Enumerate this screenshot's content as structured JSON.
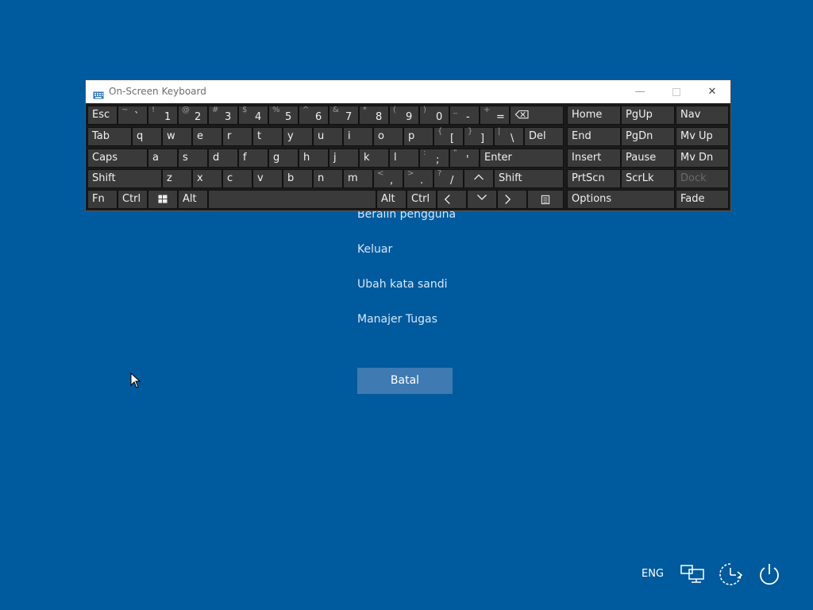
{
  "osk": {
    "title": "On-Screen Keyboard",
    "window_buttons": {
      "minimize": "—",
      "close": "✕"
    },
    "keys": {
      "esc": "Esc",
      "tilde": {
        "top": "~",
        "bottom": "`"
      },
      "d1": {
        "top": "!",
        "bottom": "1"
      },
      "d2": {
        "top": "@",
        "bottom": "2"
      },
      "d3": {
        "top": "#",
        "bottom": "3"
      },
      "d4": {
        "top": "$",
        "bottom": "4"
      },
      "d5": {
        "top": "%",
        "bottom": "5"
      },
      "d6": {
        "top": "^",
        "bottom": "6"
      },
      "d7": {
        "top": "&",
        "bottom": "7"
      },
      "d8": {
        "top": "*",
        "bottom": "8"
      },
      "d9": {
        "top": "(",
        "bottom": "9"
      },
      "d0": {
        "top": ")",
        "bottom": "0"
      },
      "minus": {
        "top": "_",
        "bottom": "-"
      },
      "equal": {
        "top": "+",
        "bottom": "="
      },
      "tab": "Tab",
      "q": "q",
      "w": "w",
      "e": "e",
      "r": "r",
      "t": "t",
      "y": "y",
      "u": "u",
      "i": "i",
      "o": "o",
      "p": "p",
      "lbracket": {
        "top": "{",
        "bottom": "["
      },
      "rbracket": {
        "top": "}",
        "bottom": "]"
      },
      "backslash": {
        "top": "|",
        "bottom": "\\"
      },
      "del": "Del",
      "caps": "Caps",
      "a": "a",
      "s": "s",
      "d": "d",
      "f": "f",
      "g": "g",
      "h": "h",
      "j": "j",
      "k": "k",
      "l": "l",
      "semicolon": {
        "top": ":",
        "bottom": ";"
      },
      "quote": {
        "top": "\"",
        "bottom": "'"
      },
      "enter": "Enter",
      "shift_left": "Shift",
      "z": "z",
      "x": "x",
      "c": "c",
      "v": "v",
      "b": "b",
      "n": "n",
      "m": "m",
      "comma": {
        "top": "<",
        "bottom": ","
      },
      "period": {
        "top": ">",
        "bottom": "."
      },
      "slash": {
        "top": "?",
        "bottom": "/"
      },
      "shift_right": "Shift",
      "fn": "Fn",
      "ctrl_left": "Ctrl",
      "alt_left": "Alt",
      "alt_right": "Alt",
      "ctrl_right": "Ctrl",
      "home": "Home",
      "pgup": "PgUp",
      "nav": "Nav",
      "end": "End",
      "pgdn": "PgDn",
      "mvup": "Mv Up",
      "insert": "Insert",
      "pause": "Pause",
      "mvdn": "Mv Dn",
      "prtscn": "PrtScn",
      "scrlk": "ScrLk",
      "dock": "Dock",
      "options": "Options",
      "fade": "Fade"
    }
  },
  "security_menu": {
    "items": [
      "Beralih pengguna",
      "Keluar",
      "Ubah kata sandi",
      "Manajer Tugas"
    ],
    "cancel": "Batal"
  },
  "tray": {
    "language": "ENG"
  }
}
